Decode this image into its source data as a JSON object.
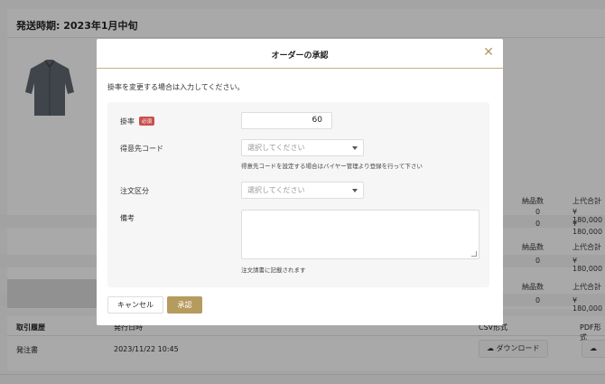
{
  "background": {
    "header_title": "発送時期: 2023年1月中旬",
    "table": {
      "col_qty": "納品数",
      "col_total": "上代合計",
      "rows": [
        {
          "qty": "0",
          "total": "¥ 180,000"
        },
        {
          "qty": "0",
          "total": "¥ 180,000"
        },
        {
          "qty": "0",
          "total": "¥ 180,000"
        },
        {
          "qty": "0",
          "total": "¥ 180,000"
        }
      ]
    },
    "history": {
      "title": "取引履歴",
      "col_date": "発行日時",
      "col_csv": "CSV形式",
      "col_pdf": "PDF形式",
      "doc_name": "発注書",
      "doc_date": "2023/11/22 10:45",
      "download_label": "ダウンロード"
    }
  },
  "modal": {
    "title": "オーダーの承認",
    "description": "掛率を変更する場合は入力してください。",
    "rate": {
      "label": "掛率",
      "badge": "必須",
      "value": "60"
    },
    "customer_code": {
      "label": "得意先コード",
      "placeholder": "選択してください",
      "hint": "得意先コードを設定する場合はバイヤー管理より登録を行って下さい"
    },
    "order_type": {
      "label": "注文区分",
      "placeholder": "選択してください"
    },
    "remarks": {
      "label": "備考",
      "hint": "注文請書に記載されます"
    },
    "cancel_label": "キャンセル",
    "approve_label": "承認"
  },
  "colors": {
    "accent": "#b59b5e",
    "required_badge": "#c9514e"
  }
}
